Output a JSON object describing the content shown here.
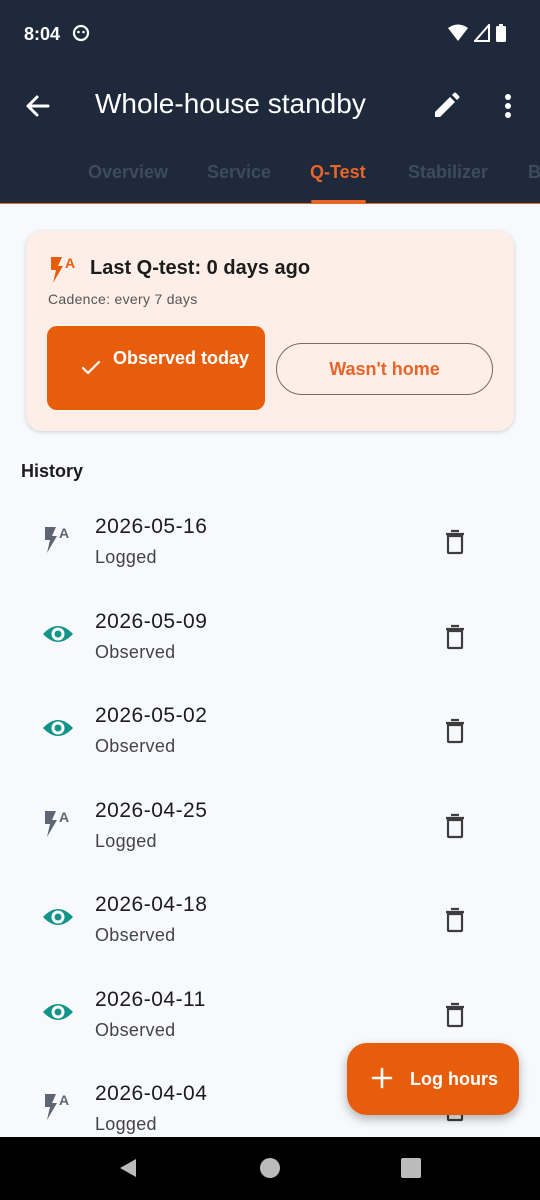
{
  "status_bar": {
    "time": "8:04"
  },
  "app_bar": {
    "title": "Whole-house standby"
  },
  "tabs": [
    {
      "label": "Overview"
    },
    {
      "label": "Service"
    },
    {
      "label": "Q-Test"
    },
    {
      "label": "Stabilizer"
    },
    {
      "label": "B"
    }
  ],
  "active_tab": "Q-Test",
  "qtest_card": {
    "heading": "Last Q-test: 0 days ago",
    "cadence": "Cadence: every 7 days",
    "observed_label": "Observed today",
    "wasnt_home_label": "Wasn't home"
  },
  "history": {
    "title": "History",
    "entries": [
      {
        "date": "2026-05-16",
        "status": "Logged",
        "icon": "auto-flash-icon"
      },
      {
        "date": "2026-05-09",
        "status": "Observed",
        "icon": "eye-icon"
      },
      {
        "date": "2026-05-02",
        "status": "Observed",
        "icon": "eye-icon"
      },
      {
        "date": "2026-04-25",
        "status": "Logged",
        "icon": "auto-flash-icon"
      },
      {
        "date": "2026-04-18",
        "status": "Observed",
        "icon": "eye-icon"
      },
      {
        "date": "2026-04-11",
        "status": "Observed",
        "icon": "eye-icon"
      },
      {
        "date": "2026-04-04",
        "status": "Logged",
        "icon": "auto-flash-icon"
      }
    ]
  },
  "fab": {
    "label": "Log hours"
  },
  "colors": {
    "app_bar": "#1e293b",
    "accent": "#e85d0c",
    "card_bg": "#fdeee7",
    "observed_icon": "#12948a",
    "logged_icon": "#5f6673"
  }
}
